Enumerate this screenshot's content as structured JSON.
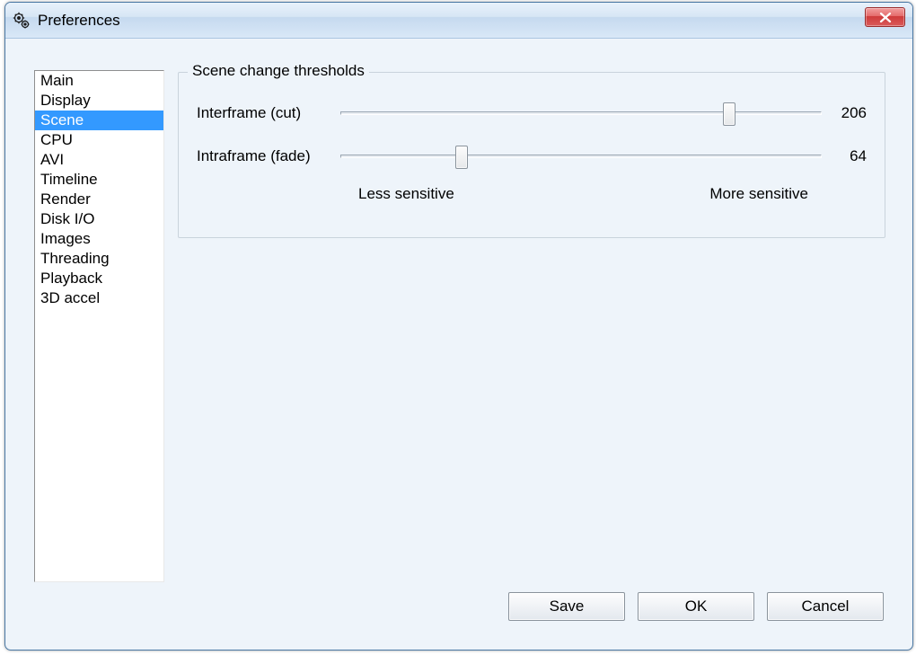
{
  "window": {
    "title": "Preferences"
  },
  "sidebar": {
    "items": [
      {
        "label": "Main",
        "selected": false
      },
      {
        "label": "Display",
        "selected": false
      },
      {
        "label": "Scene",
        "selected": true
      },
      {
        "label": "CPU",
        "selected": false
      },
      {
        "label": "AVI",
        "selected": false
      },
      {
        "label": "Timeline",
        "selected": false
      },
      {
        "label": "Render",
        "selected": false
      },
      {
        "label": "Disk I/O",
        "selected": false
      },
      {
        "label": "Images",
        "selected": false
      },
      {
        "label": "Threading",
        "selected": false
      },
      {
        "label": "Playback",
        "selected": false
      },
      {
        "label": "3D accel",
        "selected": false
      }
    ]
  },
  "group": {
    "title": "Scene change thresholds",
    "sliders": {
      "interframe": {
        "label": "Interframe (cut)",
        "value": 206,
        "min": 0,
        "max": 255
      },
      "intraframe": {
        "label": "Intraframe (fade)",
        "value": 64,
        "min": 0,
        "max": 255
      }
    },
    "less_label": "Less sensitive",
    "more_label": "More sensitive"
  },
  "buttons": {
    "save": "Save",
    "ok": "OK",
    "cancel": "Cancel"
  }
}
